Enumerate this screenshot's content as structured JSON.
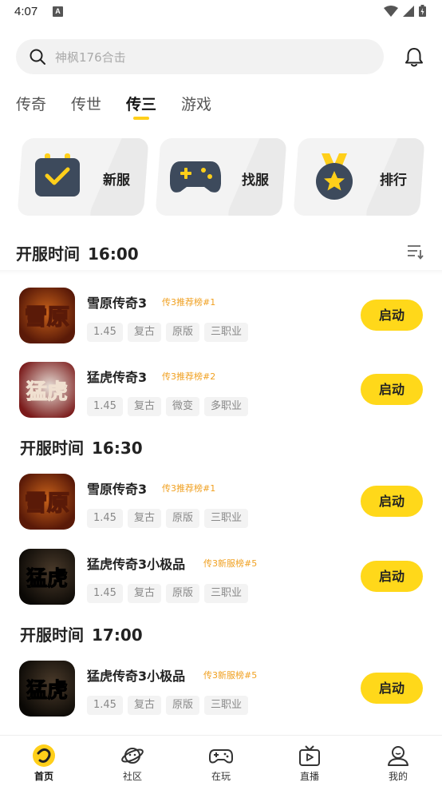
{
  "status": {
    "time": "4:07",
    "a_badge": "A"
  },
  "search": {
    "placeholder": "神枫176合击"
  },
  "tabs": [
    {
      "label": "传奇",
      "active": false
    },
    {
      "label": "传世",
      "active": false
    },
    {
      "label": "传三",
      "active": true
    },
    {
      "label": "游戏",
      "active": false
    }
  ],
  "quick": [
    {
      "label": "新服",
      "icon": "calendar-check-icon"
    },
    {
      "label": "找服",
      "icon": "gamepad-icon"
    },
    {
      "label": "排行",
      "icon": "medal-star-icon"
    }
  ],
  "sections": [
    {
      "title": "开服时间",
      "time": "16:00",
      "games": [
        {
          "name": "雪原传奇3",
          "rank": "传3推荐榜#1",
          "tags": [
            "1.45",
            "复古",
            "原版",
            "三职业"
          ],
          "button": "启动",
          "icon_text": "雪原"
        },
        {
          "name": "猛虎传奇3",
          "rank": "传3推荐榜#2",
          "tags": [
            "1.45",
            "复古",
            "微变",
            "多职业"
          ],
          "button": "启动",
          "icon_text": "猛虎"
        }
      ]
    },
    {
      "title": "开服时间",
      "time": "16:30",
      "games": [
        {
          "name": "雪原传奇3",
          "rank": "传3推荐榜#1",
          "tags": [
            "1.45",
            "复古",
            "原版",
            "三职业"
          ],
          "button": "启动",
          "icon_text": "雪原"
        },
        {
          "name": "猛虎传奇3小极品",
          "rank": "传3新服榜#5",
          "tags": [
            "1.45",
            "复古",
            "原版",
            "三职业"
          ],
          "button": "启动",
          "icon_text": "猛虎"
        }
      ]
    },
    {
      "title": "开服时间",
      "time": "17:00",
      "games": [
        {
          "name": "猛虎传奇3小极品",
          "rank": "传3新服榜#5",
          "tags": [
            "1.45",
            "复古",
            "原版",
            "三职业"
          ],
          "button": "启动",
          "icon_text": "猛虎"
        }
      ]
    }
  ],
  "nav": [
    {
      "label": "首页",
      "icon": "home-icon",
      "active": true
    },
    {
      "label": "社区",
      "icon": "planet-icon",
      "active": false
    },
    {
      "label": "在玩",
      "icon": "gamepad-icon",
      "active": false
    },
    {
      "label": "直播",
      "icon": "tv-icon",
      "active": false
    },
    {
      "label": "我的",
      "icon": "profile-icon",
      "active": false
    }
  ],
  "colors": {
    "accent": "#ffd81a",
    "rank": "#f0a020"
  }
}
